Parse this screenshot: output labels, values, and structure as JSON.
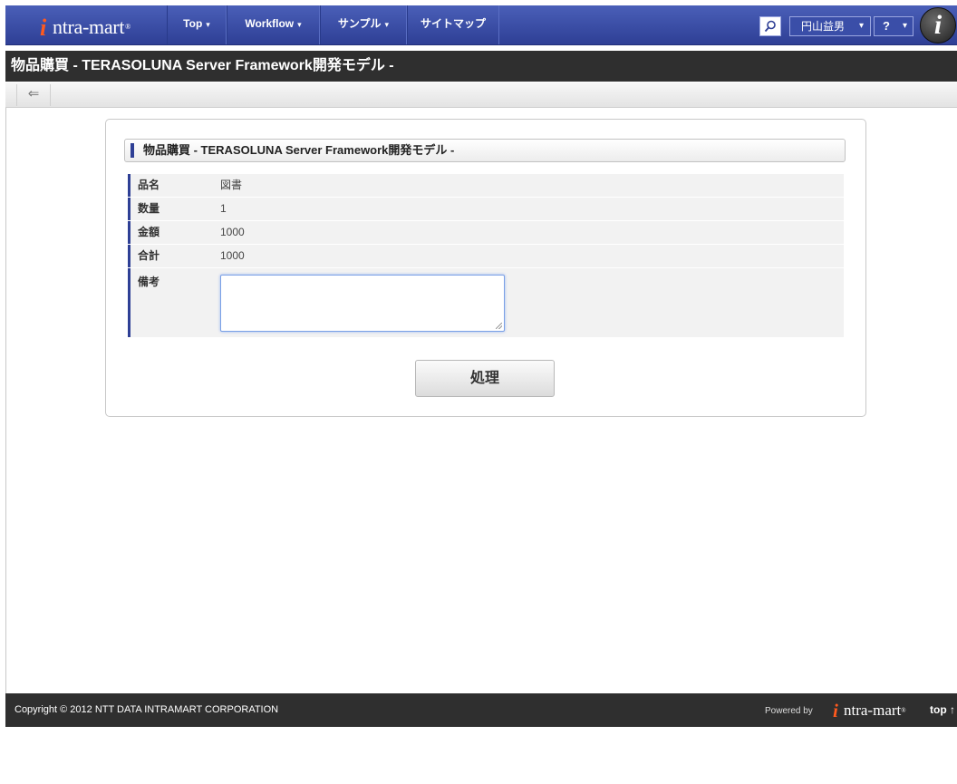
{
  "nav": {
    "logo_text": "ntra-mart",
    "items": [
      "Top",
      "Workflow",
      "サンプル",
      "サイトマップ"
    ],
    "user_name": "円山益男",
    "help_label": "?",
    "avatar_letter": "i",
    "colors": {
      "nav_bg": "#2e3f95",
      "logo_mark": "#ff5a1e"
    }
  },
  "page": {
    "title": "物品購買 - TERASOLUNA Server Framework開発モデル -"
  },
  "toolbar": {
    "back_icon": "arrow-left-icon"
  },
  "form": {
    "header": "物品購買 - TERASOLUNA Server Framework開発モデル -",
    "fields": [
      {
        "label": "品名",
        "value": "図書"
      },
      {
        "label": "数量",
        "value": "1"
      },
      {
        "label": "金額",
        "value": "1000"
      },
      {
        "label": "合計",
        "value": "1000"
      }
    ],
    "memo_label": "備考",
    "memo_value": "",
    "submit_label": "処理"
  },
  "footer": {
    "copyright": "Copyright © 2012 NTT DATA INTRAMART CORPORATION",
    "powered_by": "Powered by",
    "logo_text": "ntra-mart",
    "top_link": "top ↑"
  }
}
